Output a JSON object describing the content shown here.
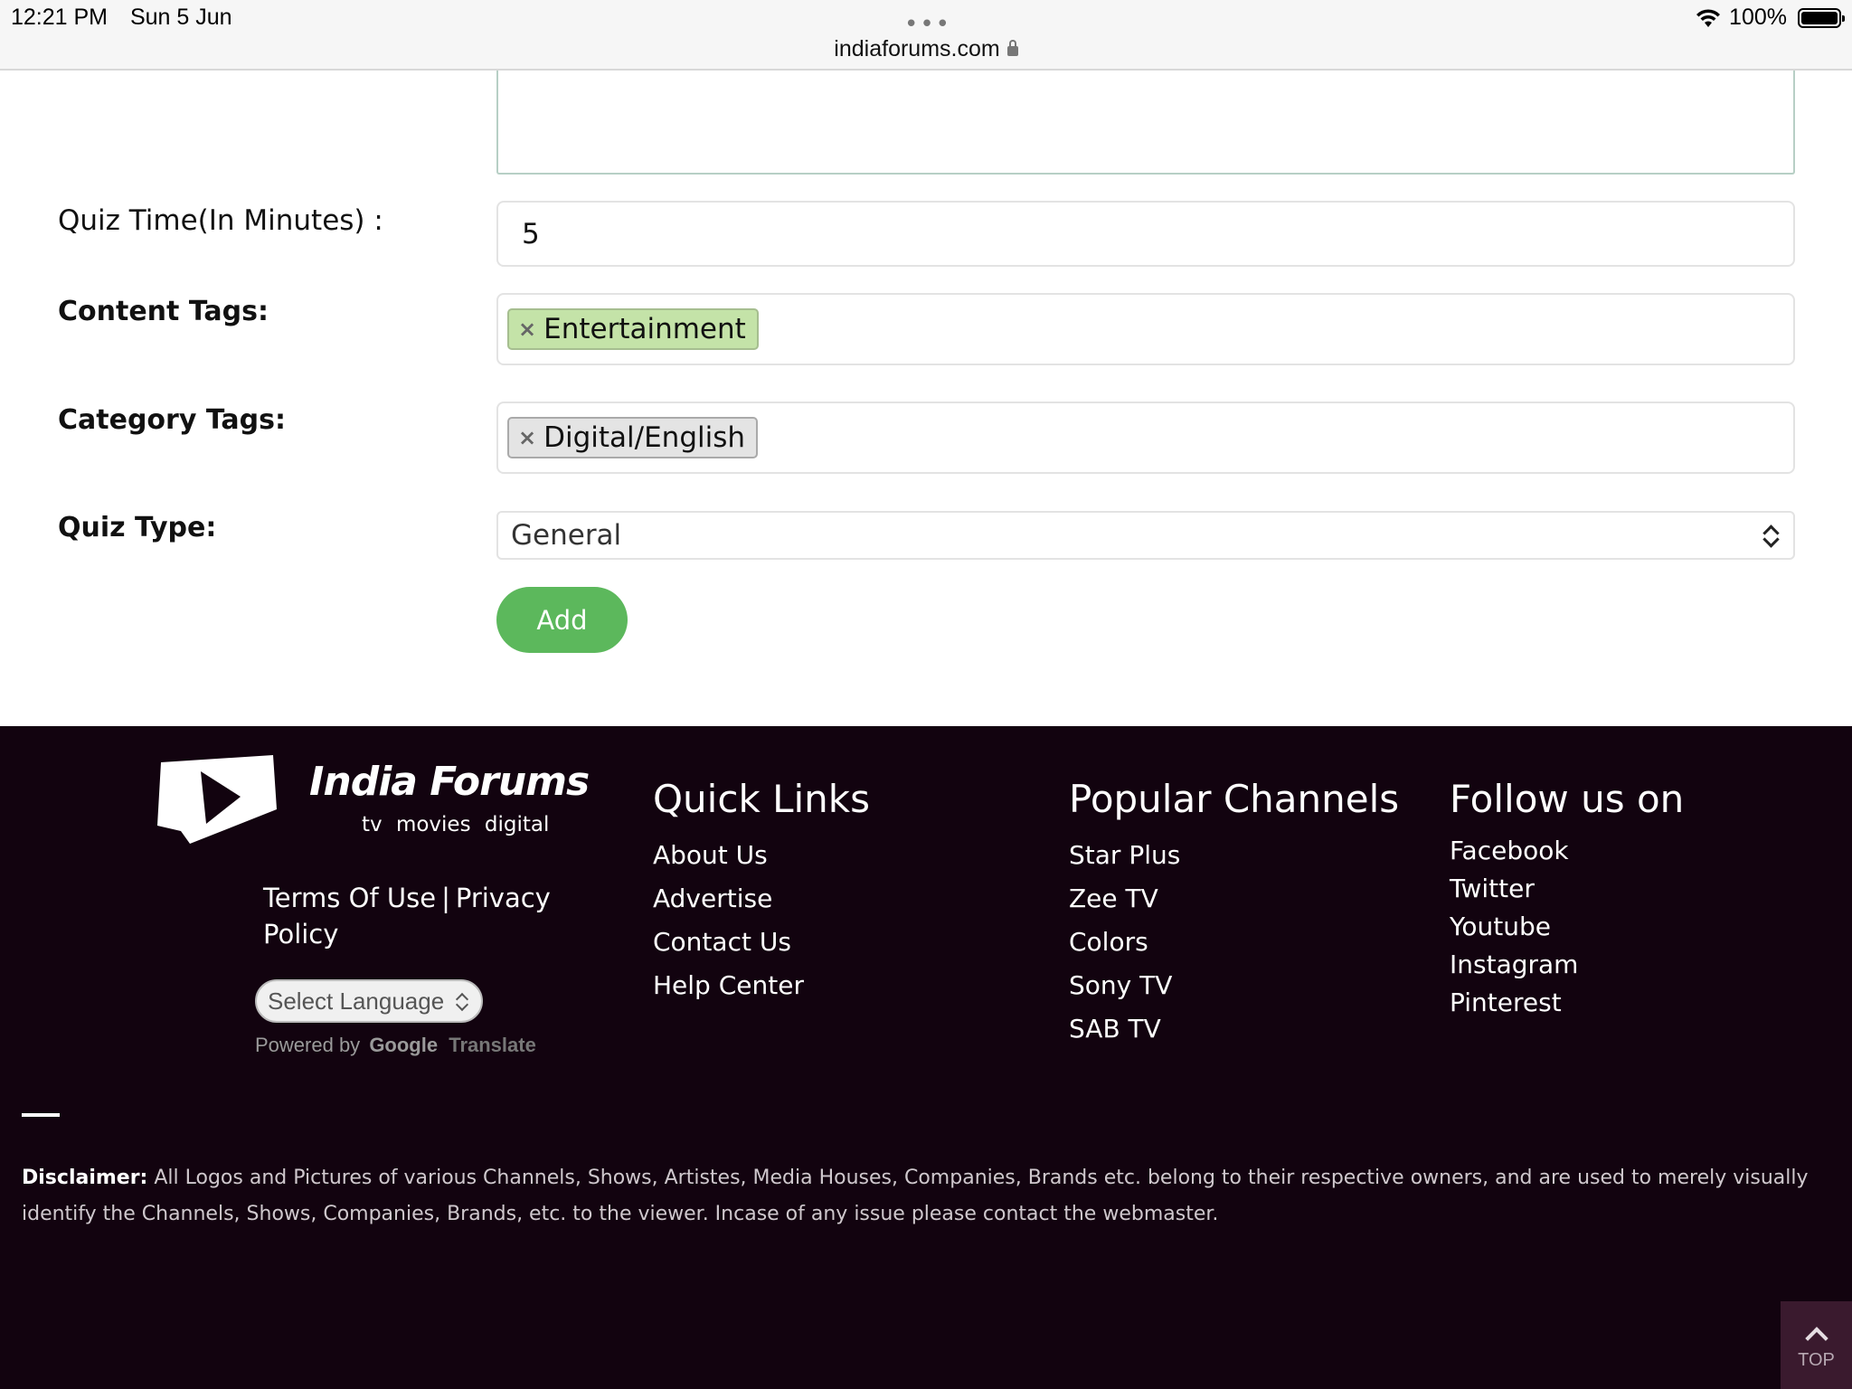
{
  "status_bar": {
    "time": "12:21 PM",
    "date": "Sun 5 Jun",
    "url": "indiaforums.com",
    "battery": "100%"
  },
  "form": {
    "quiz_time_label": "Quiz Time(In Minutes) :",
    "quiz_time_value": "5",
    "content_tags_label": "Content Tags:",
    "content_tags": [
      "Entertainment"
    ],
    "category_tags_label": "Category Tags:",
    "category_tags": [
      "Digital/English"
    ],
    "quiz_type_label": "Quiz Type:",
    "quiz_type_value": "General",
    "tag_remove_glyph": "×",
    "add_button": "Add"
  },
  "footer": {
    "logo": {
      "name": "India Forums",
      "tagline": "tv  movies  digital"
    },
    "terms": "Terms Of Use",
    "separator": "|",
    "privacy": "Privacy Policy",
    "language_select": "Select Language",
    "powered_by": "Powered by",
    "google_translate": {
      "google": "Google",
      "translate": "Translate"
    },
    "quick_links": {
      "title": "Quick Links",
      "items": [
        "About Us",
        "Advertise",
        "Contact Us",
        "Help Center"
      ]
    },
    "popular_channels": {
      "title": "Popular Channels",
      "items": [
        "Star Plus",
        "Zee TV",
        "Colors",
        "Sony TV",
        "SAB TV"
      ]
    },
    "follow_us": {
      "title": "Follow us on",
      "items": [
        "Facebook",
        "Twitter",
        "Youtube",
        "Instagram",
        "Pinterest"
      ]
    },
    "disclaimer_label": "Disclaimer:",
    "disclaimer_text": "All Logos and Pictures of various Channels, Shows, Artistes, Media Houses, Companies, Brands etc. belong to their respective owners, and are used to merely visually identify the Channels, Shows, Companies, Brands, etc. to the viewer. Incase of any issue please contact the webmaster.",
    "top_button": "TOP"
  },
  "colors": {
    "add_button": "#5cb85c",
    "footer_bg": "#12030f",
    "content_tag_bg": "#c4e3a8",
    "category_tag_bg": "#e4e4e4"
  }
}
